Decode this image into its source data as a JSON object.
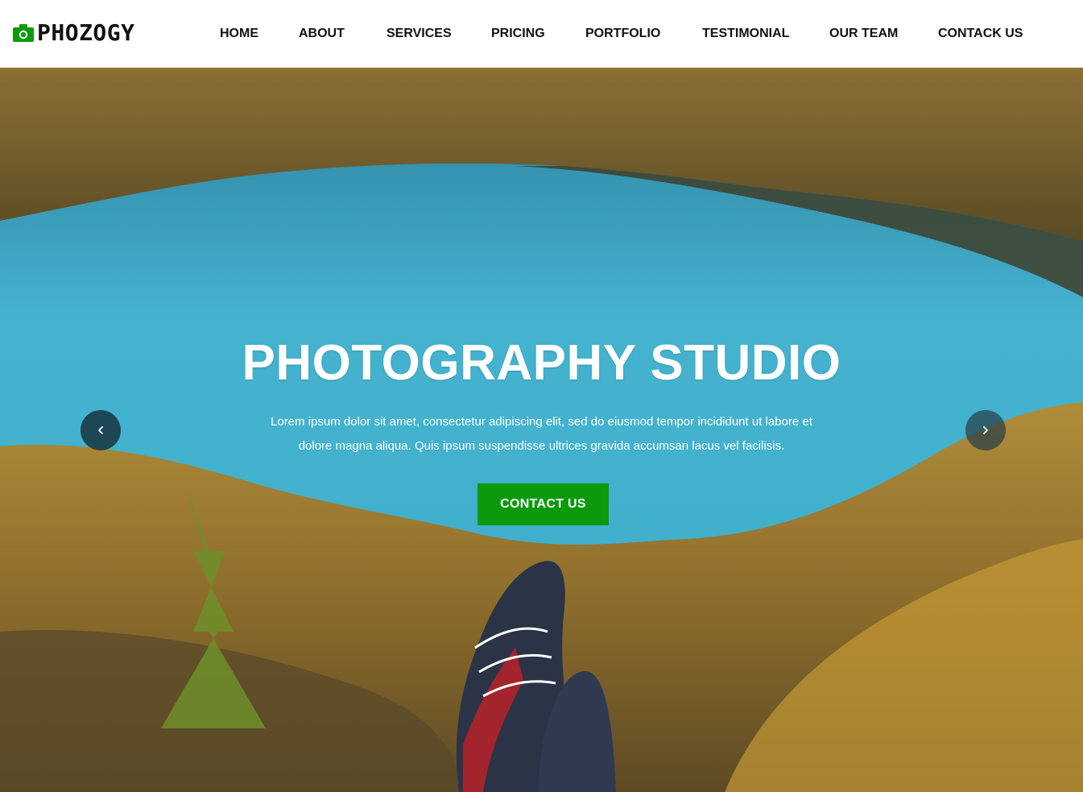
{
  "brand": {
    "name": "PHOZOGY",
    "icon": "camera-icon",
    "accent_color": "#0c9a0c"
  },
  "nav": {
    "items": [
      {
        "label": "HOME"
      },
      {
        "label": "ABOUT"
      },
      {
        "label": "SERVICES"
      },
      {
        "label": "PRICING"
      },
      {
        "label": "PORTFOLIO"
      },
      {
        "label": "TESTIMONIAL"
      },
      {
        "label": "OUR TEAM"
      },
      {
        "label": "CONTACK US"
      }
    ]
  },
  "hero": {
    "title": "PHOTOGRAPHY STUDIO",
    "description": "Lorem ipsum dolor sit amet, consectetur adipiscing elit, sed do eiusmod tempor incididunt ut labore et dolore magna aliqua. Quis ipsum suspendisse ultrices gravida accumsan lacus vel facilisis.",
    "cta_label": "CONTACT US",
    "cta_color": "#0c9a0c",
    "prev_icon": "chevron-left-icon",
    "next_icon": "chevron-right-icon"
  }
}
